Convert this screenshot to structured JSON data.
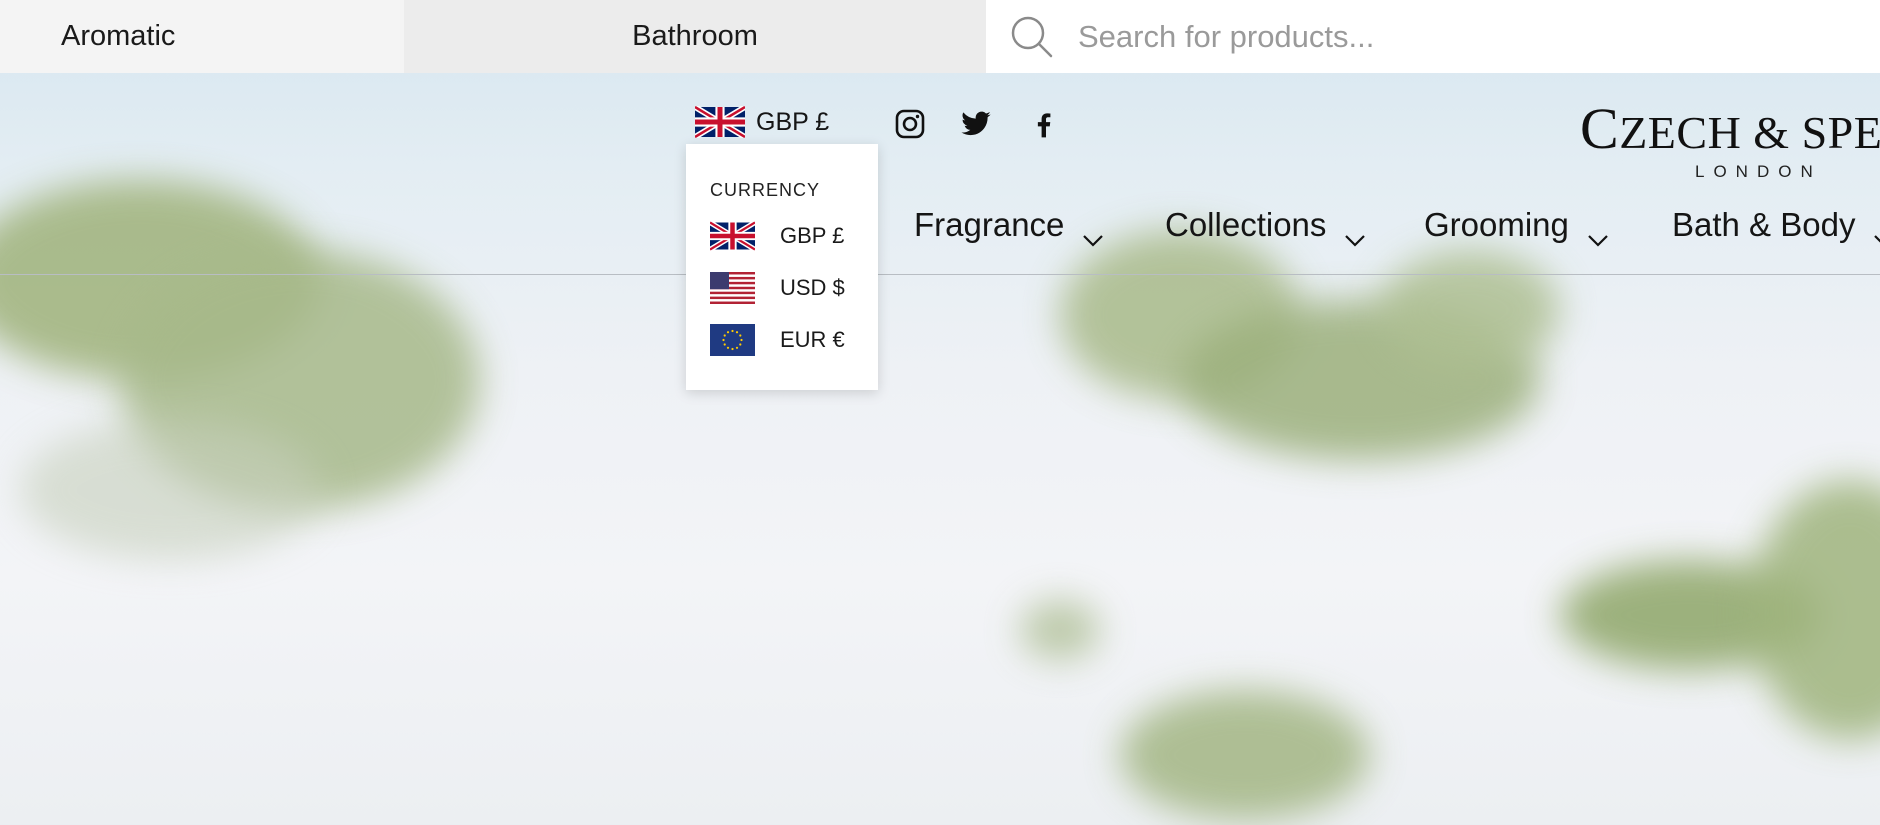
{
  "topbar": {
    "categories": [
      "Aromatic",
      "Bathroom"
    ],
    "search": {
      "placeholder": "Search for products...",
      "value": ""
    }
  },
  "currency": {
    "selected_label": "GBP £",
    "dropdown": {
      "heading": "CURRENCY",
      "options": [
        {
          "label": "GBP £",
          "flag": "uk-flag-icon"
        },
        {
          "label": "USD $",
          "flag": "us-flag-icon"
        },
        {
          "label": "EUR €",
          "flag": "eu-flag-icon"
        }
      ]
    }
  },
  "social": [
    "instagram-icon",
    "twitter-icon",
    "facebook-icon"
  ],
  "logo": {
    "main_initial": "C",
    "main_rest": "ZECH & SPEAK",
    "sub": "LONDON"
  },
  "nav": {
    "items": [
      {
        "label": "Fragrance"
      },
      {
        "label": "Collections"
      },
      {
        "label": "Grooming"
      },
      {
        "label": "Bath & Body"
      }
    ]
  },
  "colors": {
    "foliage": "#8fa86b",
    "sky": "#d6e6f0",
    "text": "#151515"
  }
}
